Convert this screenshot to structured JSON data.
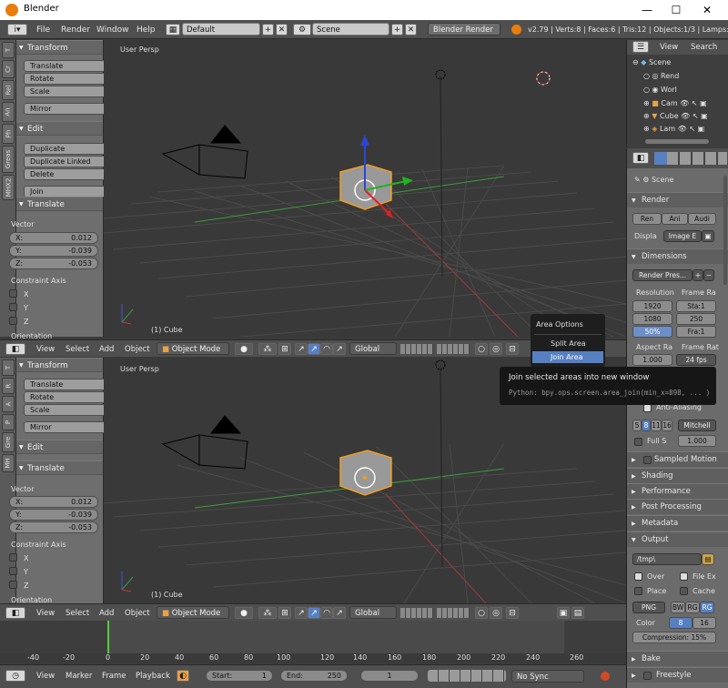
{
  "window": {
    "title": "Blender",
    "min": "—",
    "max": "☐",
    "close": "✕"
  },
  "info": {
    "menus": [
      "File",
      "Render",
      "Window",
      "Help"
    ],
    "layout": "Default",
    "scene": "Scene",
    "engine": "Blender Render",
    "stats": "v2.79 | Verts:8 | Faces:6 | Tris:12 | Objects:1/3 | Lamps:0/..."
  },
  "tabs_top": [
    "T",
    "Cr",
    "Rel",
    "An",
    "Ph",
    "Greas",
    "MHX2"
  ],
  "tabs_bottom": [
    "T",
    "R",
    "A",
    "P",
    "Gre",
    "MH"
  ],
  "tools": {
    "transform": "Transform",
    "translate": "Translate",
    "rotate": "Rotate",
    "scale": "Scale",
    "mirror": "Mirror",
    "edit": "Edit",
    "duplicate": "Duplicate",
    "duplicate_linked": "Duplicate Linked",
    "delete": "Delete",
    "join": "Join"
  },
  "op": {
    "title": "Translate",
    "vector": "Vector",
    "x_label": "X:",
    "x": "0.012",
    "y_label": "Y:",
    "y": "-0.039",
    "z_label": "Z:",
    "z": "-0.053",
    "constraint": "Constraint Axis",
    "cx": "X",
    "cy": "Y",
    "cz": "Z",
    "orientation": "Orientation"
  },
  "viewport": {
    "persp": "User Persp",
    "object": "(1) Cube"
  },
  "vpheader": {
    "view": "View",
    "select": "Select",
    "add": "Add",
    "object": "Object",
    "mode": "Object Mode",
    "orientation": "Global"
  },
  "context_menu": {
    "title": "Area Options",
    "split": "Split Area",
    "join": "Join Area"
  },
  "tooltip": {
    "text": "Join selected areas into new window",
    "python": "Python: bpy.ops.screen.area_join(min_x=898, ... )"
  },
  "outliner": {
    "view": "View",
    "search": "Search",
    "items": [
      "Scene",
      "Rend",
      "Worl",
      "Cam",
      "Cube",
      "Lam"
    ]
  },
  "props": {
    "scene": "Scene",
    "render": "Render",
    "btn_render": "Ren",
    "btn_anim": "Ani",
    "btn_audio": "Audi",
    "display": "Displa",
    "display_val": "Image E",
    "dimensions": "Dimensions",
    "presets": "Render Pres...",
    "resolution": "Resolution",
    "res_x": "1920",
    "res_y": "1080",
    "res_pct": "50%",
    "frame_range": "Frame Ra",
    "start": "Sta:1",
    "end": "250",
    "step": "Fra:1",
    "aspect": "Aspect Ra",
    "aspect_val": "1.000",
    "frame_rate": "Frame Rat",
    "fps": "24 fps",
    "aa": "Anti-Aliasing",
    "aa_nums": [
      "5",
      "8",
      "11",
      "16"
    ],
    "filter": "Mitchell",
    "full": "Full S",
    "full_val": "1.000",
    "sampled": "Sampled Motion",
    "shading": "Shading",
    "performance": "Performance",
    "post": "Post Processing",
    "metadata": "Metadata",
    "output": "Output",
    "path": "/tmp\\",
    "over": "Over",
    "file_ext": "File Ex",
    "place": "Place",
    "cache": "Cache",
    "format": "PNG",
    "bw": "BW",
    "rgb": "RG",
    "rgba": "RG",
    "color": "Color",
    "depth8": "8",
    "depth16": "16",
    "compression": "Compression: 15%",
    "bake": "Bake",
    "freestyle": "Freestyle"
  },
  "timeline": {
    "ticks": [
      "-40",
      "-20",
      "0",
      "20",
      "40",
      "60",
      "80",
      "100",
      "120",
      "140",
      "160",
      "180",
      "200",
      "220",
      "240",
      "260"
    ],
    "view": "View",
    "marker": "Marker",
    "frame": "Frame",
    "playback": "Playback",
    "start": "Start:",
    "start_val": "1",
    "end": "End:",
    "end_val": "250",
    "current": "1",
    "sync": "No Sync"
  }
}
